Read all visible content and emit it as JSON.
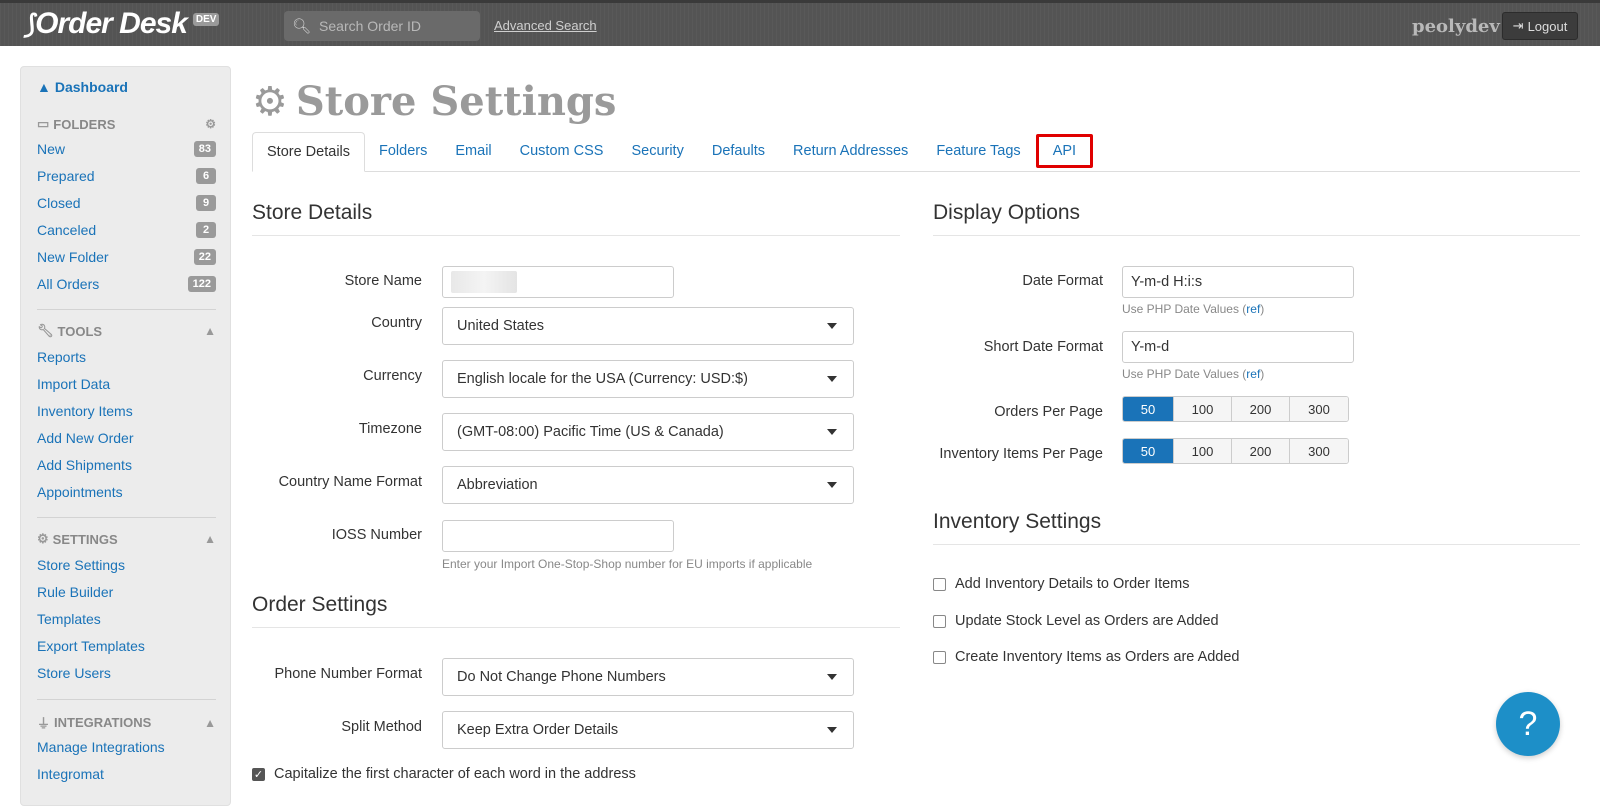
{
  "header": {
    "logo_text": "Order Desk",
    "env_badge": "DEV",
    "search_placeholder": "Search Order ID",
    "advanced_search": "Advanced Search",
    "username": "peolydev",
    "logout": "Logout"
  },
  "sidebar": {
    "dashboard": "Dashboard",
    "folders_head": "FOLDERS",
    "folders": [
      {
        "label": "New",
        "count": "83"
      },
      {
        "label": "Prepared",
        "count": "6"
      },
      {
        "label": "Closed",
        "count": "9"
      },
      {
        "label": "Canceled",
        "count": "2"
      },
      {
        "label": "New Folder",
        "count": "22"
      },
      {
        "label": "All Orders",
        "count": "122"
      }
    ],
    "tools_head": "TOOLS",
    "tools": [
      "Reports",
      "Import Data",
      "Inventory Items",
      "Add New Order",
      "Add Shipments",
      "Appointments"
    ],
    "settings_head": "SETTINGS",
    "settings": [
      "Store Settings",
      "Rule Builder",
      "Templates",
      "Export Templates",
      "Store Users"
    ],
    "integrations_head": "INTEGRATIONS",
    "integrations": [
      "Manage Integrations",
      "Integromat"
    ]
  },
  "page": {
    "title": "Store Settings",
    "tabs": [
      "Store Details",
      "Folders",
      "Email",
      "Custom CSS",
      "Security",
      "Defaults",
      "Return Addresses",
      "Feature Tags",
      "API"
    ]
  },
  "store_details": {
    "title": "Store Details",
    "store_name_label": "Store Name",
    "country_label": "Country",
    "country_value": "United States",
    "currency_label": "Currency",
    "currency_value": "English locale for the USA (Currency: USD:$)",
    "timezone_label": "Timezone",
    "timezone_value": "(GMT-08:00) Pacific Time (US & Canada)",
    "country_name_format_label": "Country Name Format",
    "country_name_format_value": "Abbreviation",
    "ioss_label": "IOSS Number",
    "ioss_value": "",
    "ioss_help": "Enter your Import One-Stop-Shop number for EU imports if applicable"
  },
  "order_settings": {
    "title": "Order Settings",
    "phone_label": "Phone Number Format",
    "phone_value": "Do Not Change Phone Numbers",
    "split_label": "Split Method",
    "split_value": "Keep Extra Order Details",
    "capitalize_label": "Capitalize the first character of each word in the address",
    "capitalize_checked": true
  },
  "display_options": {
    "title": "Display Options",
    "date_format_label": "Date Format",
    "date_format_value": "Y-m-d H:i:s",
    "short_date_label": "Short Date Format",
    "short_date_value": "Y-m-d",
    "php_help": "Use PHP Date Values (",
    "php_help_link": "ref",
    "php_help_end": ")",
    "orders_per_page_label": "Orders Per Page",
    "inventory_per_page_label": "Inventory Items Per Page",
    "page_options": [
      "50",
      "100",
      "200",
      "300"
    ],
    "orders_per_page_selected": "50",
    "inventory_per_page_selected": "50"
  },
  "inventory_settings": {
    "title": "Inventory Settings",
    "options": [
      {
        "label": "Add Inventory Details to Order Items",
        "checked": false
      },
      {
        "label": "Update Stock Level as Orders are Added",
        "checked": false
      },
      {
        "label": "Create Inventory Items as Orders are Added",
        "checked": false
      }
    ]
  },
  "help_fab": "?",
  "colors": {
    "link": "#1a73b8",
    "highlight": "#e00000",
    "active_button": "#1a73b8"
  }
}
